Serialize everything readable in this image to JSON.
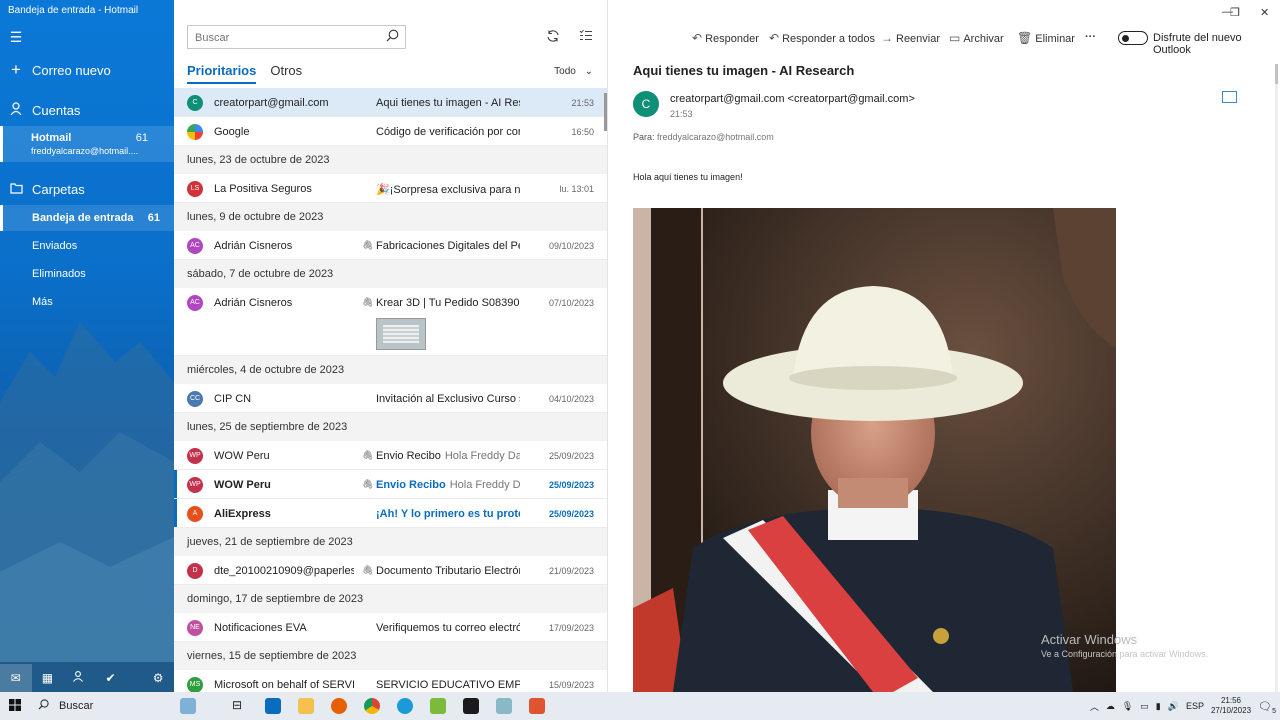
{
  "app": {
    "window_title": "Bandeja de entrada - Hotmail"
  },
  "sidebar": {
    "new_mail": "Correo nuevo",
    "accounts_label": "Cuentas",
    "account": {
      "name": "Hotmail",
      "count": "61",
      "email": "freddyalcarazo@hotmail...."
    },
    "folders_label": "Carpetas",
    "folders": [
      {
        "label": "Bandeja de entrada",
        "count": "61"
      },
      {
        "label": "Enviados",
        "count": ""
      },
      {
        "label": "Eliminados",
        "count": ""
      },
      {
        "label": "Más",
        "count": ""
      }
    ]
  },
  "list": {
    "search_placeholder": "Buscar",
    "tab_focused": "Prioritarios",
    "tab_other": "Otros",
    "filter_label": "Todo",
    "rows": [
      {
        "kind": "msg",
        "initials": "C",
        "color": "#0d8f78",
        "sender": "creatorpart@gmail.com",
        "subject": "Aqui tienes tu imagen - AI Resea",
        "preview": "",
        "time": "21:53",
        "attach": false,
        "selected": true,
        "unread": false
      },
      {
        "kind": "msg",
        "initials": "G",
        "color": "google",
        "sender": "Google",
        "subject": "Código de verificación por corre",
        "preview": "",
        "time": "16:50",
        "attach": false
      },
      {
        "kind": "date",
        "label": "lunes, 23 de octubre de 2023"
      },
      {
        "kind": "msg",
        "initials": "LS",
        "color": "#d13438",
        "sender": "La Positiva Seguros",
        "subject": "🎉¡Sorpresa exclusiva para nues",
        "preview": "",
        "time": "lu. 13:01",
        "attach": false
      },
      {
        "kind": "date",
        "label": "lunes, 9 de octubre de 2023"
      },
      {
        "kind": "msg",
        "initials": "AC",
        "color": "#b146c2",
        "sender": "Adrián Cisneros",
        "subject": "Fabricaciones Digitales del Peru S",
        "preview": "",
        "time": "09/10/2023",
        "attach": true
      },
      {
        "kind": "date",
        "label": "sábado, 7 de octubre de 2023"
      },
      {
        "kind": "msg",
        "initials": "AC",
        "color": "#b146c2",
        "sender": "Adrián Cisneros",
        "subject": "Krear 3D | Tu Pedido S08390 fue",
        "preview": "",
        "time": "07/10/2023",
        "attach": true,
        "thumb": true
      },
      {
        "kind": "date",
        "label": "miércoles, 4 de octubre de 2023"
      },
      {
        "kind": "msg",
        "initials": "CC",
        "color": "#4a7ab0",
        "sender": "CIP CN",
        "subject": "Invitación al Exclusivo Curso sob",
        "preview": "",
        "time": "04/10/2023",
        "attach": false
      },
      {
        "kind": "date",
        "label": "lunes, 25 de septiembre de 2023"
      },
      {
        "kind": "msg",
        "initials": "WP",
        "color": "#c4314b",
        "sender": "WOW Peru",
        "subject": "Envio Recibo",
        "preview": "Hola Freddy Danie",
        "time": "25/09/2023",
        "attach": true
      },
      {
        "kind": "msg",
        "initials": "WP",
        "color": "#c4314b",
        "sender": "WOW Peru",
        "subject": "Envio Recibo",
        "preview": "Hola Freddy Danie",
        "time": "25/09/2023",
        "attach": true,
        "unread": true
      },
      {
        "kind": "msg",
        "initials": "A",
        "color": "#e8501b",
        "sender": "AliExpress",
        "subject": "¡Ah! Y lo primero es tu protecció",
        "preview": "",
        "time": "25/09/2023",
        "attach": false,
        "unread": true
      },
      {
        "kind": "date",
        "label": "jueves, 21 de septiembre de 2023"
      },
      {
        "kind": "msg",
        "initials": "D",
        "color": "#c4314b",
        "sender": "dte_20100210909@paperless.",
        "subject": "Documento Tributario Electrónic",
        "preview": "",
        "time": "21/09/2023",
        "attach": true
      },
      {
        "kind": "date",
        "label": "domingo, 17 de septiembre de 2023"
      },
      {
        "kind": "msg",
        "initials": "NE",
        "color": "#c04fa0",
        "sender": "Notificaciones EVA",
        "subject": "Verifiquemos tu correo electróni",
        "preview": "",
        "time": "17/09/2023",
        "attach": false
      },
      {
        "kind": "date",
        "label": "viernes, 15 de septiembre de 2023"
      },
      {
        "kind": "msg",
        "initials": "MS",
        "color": "#2e9e3e",
        "sender": "Microsoft on behalf of SERVIC",
        "subject": "SERVICIO EDUCATIVO EMPRESA",
        "preview": "",
        "time": "15/09/2023",
        "attach": false
      }
    ]
  },
  "toolbar": {
    "reply": "Responder",
    "reply_all": "Responder a todos",
    "forward": "Reenviar",
    "archive": "Archivar",
    "delete": "Eliminar",
    "more": "···",
    "new_outlook": "Disfrute del nuevo Outlook"
  },
  "reader": {
    "subject": "Aqui tienes tu imagen - AI Research",
    "avatar_initial": "C",
    "from": "creatorpart@gmail.com <creatorpart@gmail.com>",
    "time": "21:53",
    "to_label": "Para:",
    "to_addr": "freddyalcarazo@hotmail.com",
    "body": "Hola aquí tienes tu imagen!"
  },
  "watermark": {
    "title": "Activar Windows",
    "subtitle": "Ve a Configuración para activar Windows."
  },
  "taskbar": {
    "search": "Buscar",
    "lang": "ESP",
    "time": "21:56",
    "date": "27/10/2023",
    "notif": "5"
  }
}
